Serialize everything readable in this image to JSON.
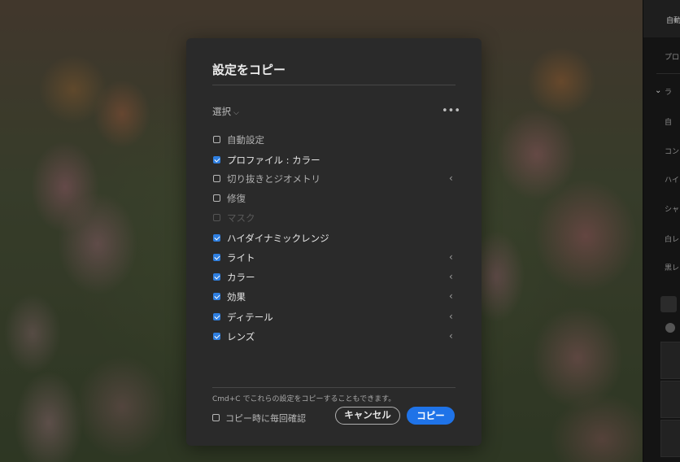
{
  "dialog": {
    "title": "設定をコピー",
    "select_label": "選択",
    "items": [
      {
        "label": "自動設定",
        "checked": false,
        "state": "dim",
        "chevron": false
      },
      {
        "label": "プロファイル : カラー",
        "checked": true,
        "state": "normal",
        "chevron": false
      },
      {
        "label": "切り抜きとジオメトリ",
        "checked": false,
        "state": "dim",
        "chevron": true
      },
      {
        "label": "修復",
        "checked": false,
        "state": "dim",
        "chevron": false
      },
      {
        "label": "マスク",
        "checked": false,
        "state": "disabled",
        "chevron": false
      },
      {
        "label": "ハイダイナミックレンジ",
        "checked": true,
        "state": "normal",
        "chevron": false
      },
      {
        "label": "ライト",
        "checked": true,
        "state": "normal",
        "chevron": true
      },
      {
        "label": "カラー",
        "checked": true,
        "state": "normal",
        "chevron": true
      },
      {
        "label": "効果",
        "checked": true,
        "state": "normal",
        "chevron": true
      },
      {
        "label": "ディテール",
        "checked": true,
        "state": "normal",
        "chevron": true
      },
      {
        "label": "レンズ",
        "checked": true,
        "state": "normal",
        "chevron": true
      }
    ],
    "hint": "Cmd+C でこれらの設定をコピーすることもできます。",
    "confirm_label": "コピー時に毎回確認",
    "confirm_checked": false,
    "cancel_label": "キャンセル",
    "copy_label": "コピー"
  },
  "right_panel": {
    "top_label": "自動",
    "rows": [
      "プロ",
      "ラ",
      "自",
      "コン",
      "ハイ",
      "シャ",
      "白レ",
      "黒レ"
    ]
  },
  "colors": {
    "accent": "#1f73e8",
    "dialog_bg": "#2a2a2a",
    "checkbox_checked": "#2f7fe0"
  },
  "icons": {
    "select": "chevron-down-icon",
    "more": "more-horizontal-icon",
    "item_expand": "chevron-left-icon"
  }
}
